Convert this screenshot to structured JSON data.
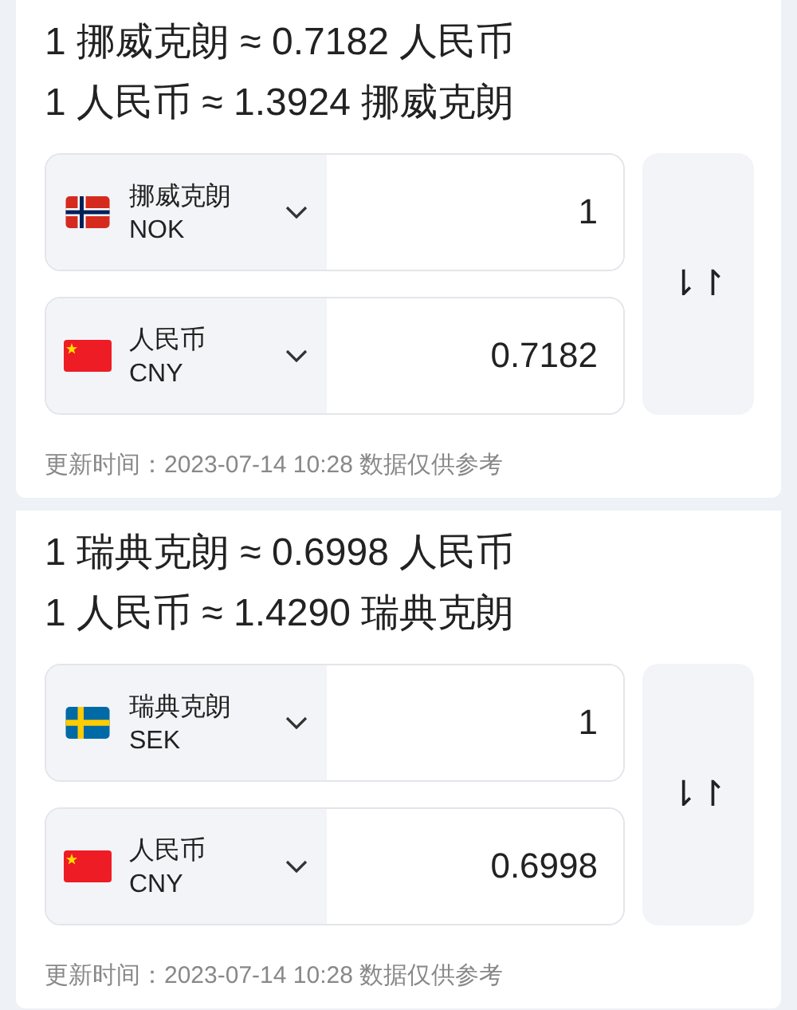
{
  "cards": [
    {
      "rate_lines": [
        "1 挪威克朗 ≈ 0.7182 人民币",
        "1 人民币 ≈ 1.3924 挪威克朗"
      ],
      "rows": [
        {
          "kind": "no",
          "name": "挪威克朗",
          "code": "NOK",
          "value": "1"
        },
        {
          "kind": "cn",
          "name": "人民币",
          "code": "CNY",
          "value": "0.7182"
        }
      ],
      "swap": "⇂↾",
      "footer": "更新时间：2023-07-14 10:28 数据仅供参考"
    },
    {
      "rate_lines": [
        "1 瑞典克朗 ≈ 0.6998 人民币",
        "1 人民币 ≈ 1.4290 瑞典克朗"
      ],
      "rows": [
        {
          "kind": "se",
          "name": "瑞典克朗",
          "code": "SEK",
          "value": "1"
        },
        {
          "kind": "cn",
          "name": "人民币",
          "code": "CNY",
          "value": "0.6998"
        }
      ],
      "swap": "⇂↾",
      "footer": "更新时间：2023-07-14 10:28 数据仅供参考"
    }
  ]
}
